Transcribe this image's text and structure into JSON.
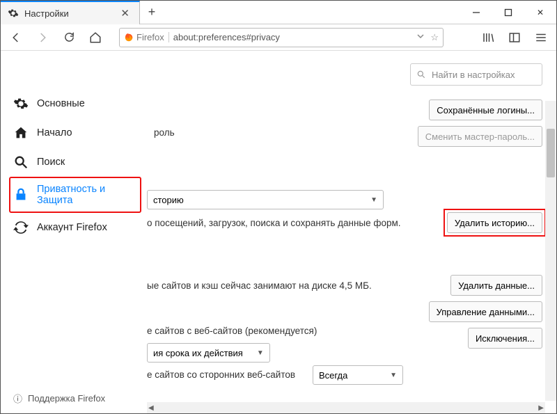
{
  "tab": {
    "title": "Настройки"
  },
  "addressbar": {
    "identity": "Firefox",
    "url": "about:preferences#privacy"
  },
  "search": {
    "placeholder": "Найти в настройках"
  },
  "sidebar": {
    "items": [
      {
        "label": "Основные"
      },
      {
        "label": "Начало"
      },
      {
        "label": "Поиск"
      },
      {
        "label": "Приватность и Защита"
      },
      {
        "label": "Аккаунт Firefox"
      }
    ],
    "support": "Поддержка Firefox"
  },
  "buttons": {
    "saved_logins": "Сохранённые логины...",
    "change_master": "Сменить мастер-пароль...",
    "clear_history": "Удалить историю...",
    "clear_data": "Удалить данные...",
    "manage_data": "Управление данными...",
    "exceptions": "Исключения..."
  },
  "texts": {
    "frag_pw": "роль",
    "dd_history": "сторию",
    "history_desc": "о посещений, загрузок, поиска и сохранять данные форм.",
    "cache_desc": "ые сайтов и кэш сейчас занимают на диске 4,5 МБ.",
    "cookies_rec": "е сайтов с веб-сайтов (рекомендуется)",
    "until_expire": "ия срока их действия",
    "third_party": "е сайтов со сторонних веб-сайтов",
    "always": "Всегда"
  }
}
